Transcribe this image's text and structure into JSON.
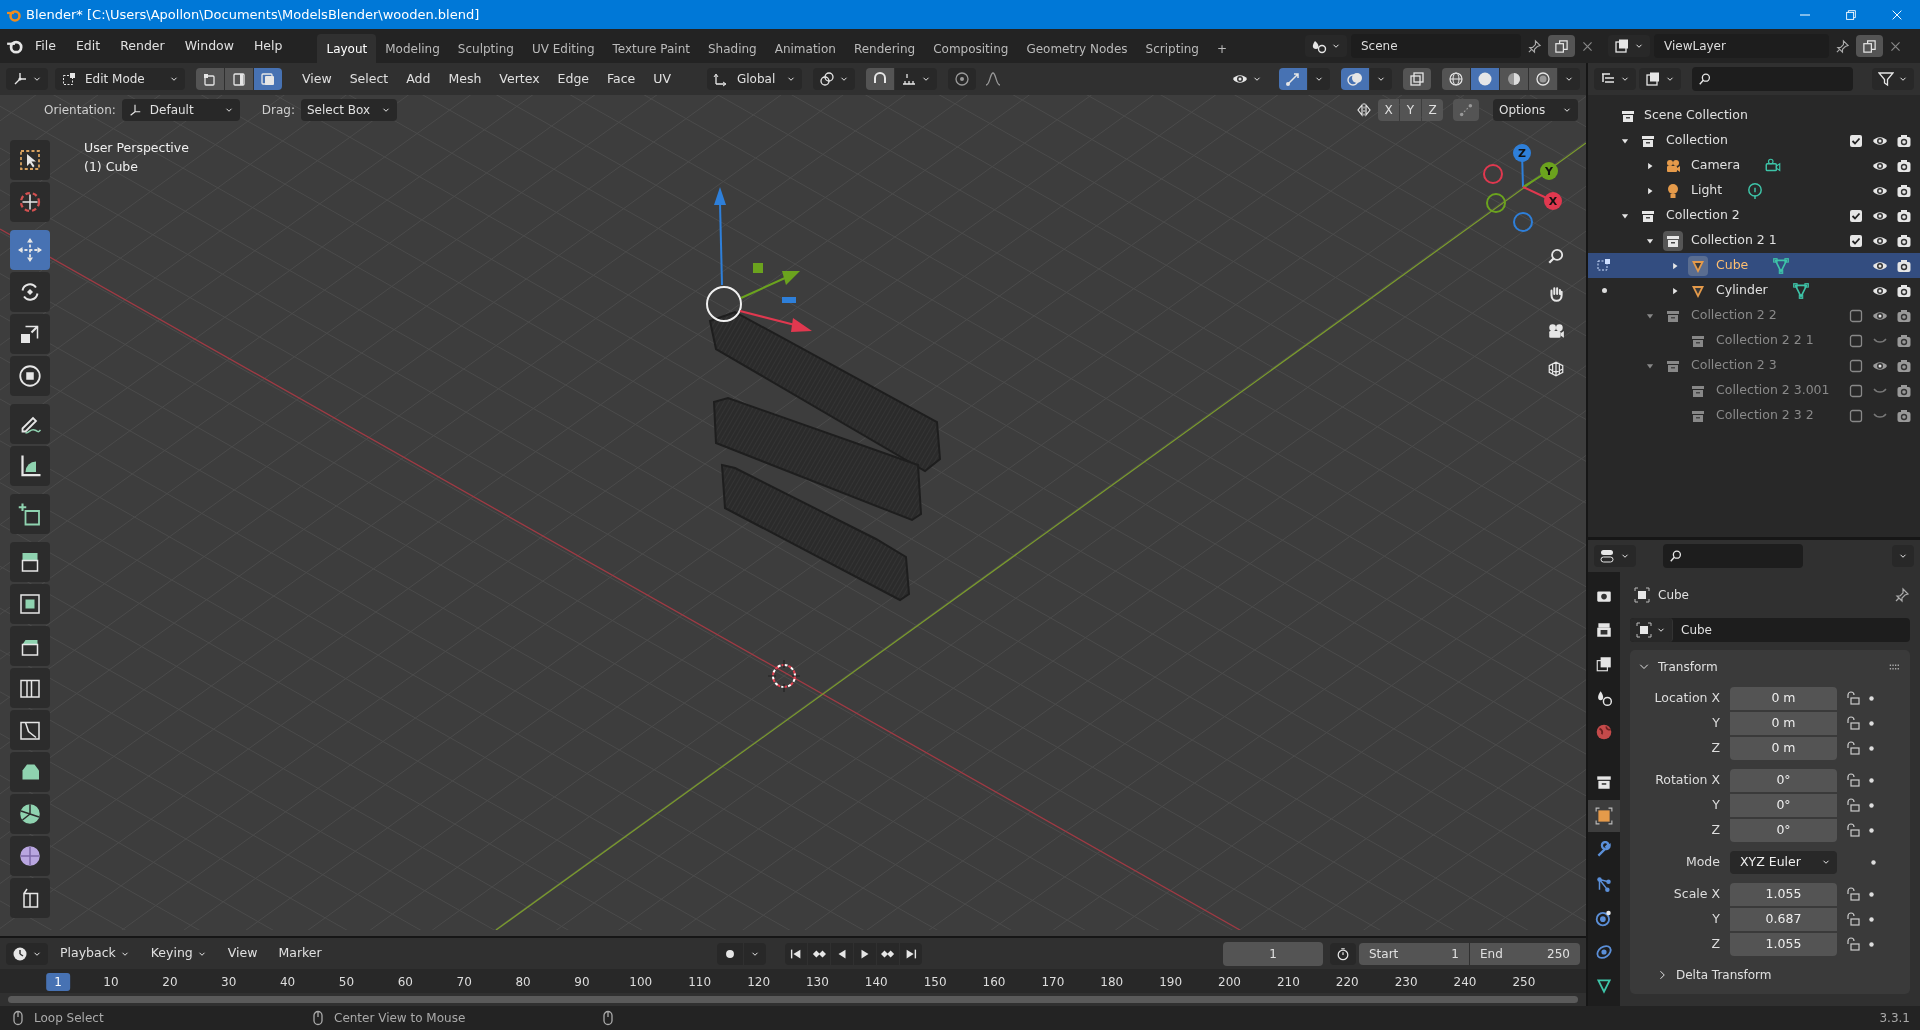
{
  "window": {
    "title": "Blender* [C:\\Users\\Apollon\\Documents\\ModelsBlender\\wooden.blend]"
  },
  "menu": [
    "File",
    "Edit",
    "Render",
    "Window",
    "Help"
  ],
  "workspaces": [
    {
      "label": "Layout",
      "selected": true
    },
    {
      "label": "Modeling",
      "selected": false
    },
    {
      "label": "Sculpting",
      "selected": false
    },
    {
      "label": "UV Editing",
      "selected": false
    },
    {
      "label": "Texture Paint",
      "selected": false
    },
    {
      "label": "Shading",
      "selected": false
    },
    {
      "label": "Animation",
      "selected": false
    },
    {
      "label": "Rendering",
      "selected": false
    },
    {
      "label": "Compositing",
      "selected": false
    },
    {
      "label": "Geometry Nodes",
      "selected": false
    },
    {
      "label": "Scripting",
      "selected": false
    }
  ],
  "add_workspace": "+",
  "scene": {
    "name": "Scene"
  },
  "view_layer": {
    "name": "ViewLayer"
  },
  "viewport_header": {
    "mode": "Edit Mode",
    "select_modes": [
      {
        "kind": "vertex",
        "selected": false
      },
      {
        "kind": "edge",
        "selected": false
      },
      {
        "kind": "face",
        "selected": true
      }
    ],
    "menus": [
      "View",
      "Select",
      "Add",
      "Mesh",
      "Vertex",
      "Edge",
      "Face",
      "UV"
    ],
    "orientation": "Global",
    "snap": {
      "on": false
    },
    "gizmos": {
      "on": true
    },
    "overlays": {
      "on": true
    },
    "xray": {
      "on": false
    },
    "shading": [
      {
        "kind": "wireframe",
        "selected": false
      },
      {
        "kind": "solid",
        "selected": true
      },
      {
        "kind": "material",
        "selected": false
      },
      {
        "kind": "rendered",
        "selected": false
      }
    ]
  },
  "tool_settings": {
    "orientation_label": "Orientation:",
    "orientation": "Default",
    "drag_label": "Drag:",
    "drag": "Select Box",
    "mirror_axes": [
      {
        "label": "X",
        "on": false
      },
      {
        "label": "Y",
        "on": false
      },
      {
        "label": "Z",
        "on": false
      }
    ],
    "options": "Options"
  },
  "viewport": {
    "overlay_text": [
      "User Perspective",
      "(1) Cube"
    ],
    "axes": [
      {
        "label": "Z",
        "color": "#2e7fd9"
      },
      {
        "label": "Y",
        "color": "#6ba31e"
      },
      {
        "label": "X",
        "color": "#e0384f"
      }
    ]
  },
  "toolbar": {
    "groups": [
      [
        {
          "kind": "select_box",
          "selected": false
        },
        {
          "kind": "cursor",
          "selected": false
        }
      ],
      [
        {
          "kind": "move",
          "selected": true
        },
        {
          "kind": "rotate",
          "selected": false
        },
        {
          "kind": "scale",
          "selected": false
        },
        {
          "kind": "transform",
          "selected": false
        }
      ],
      [
        {
          "kind": "annotate",
          "selected": false
        },
        {
          "kind": "measure",
          "selected": false
        }
      ],
      [
        {
          "kind": "add_cube",
          "selected": false
        }
      ],
      [
        {
          "kind": "extrude",
          "selected": false
        },
        {
          "kind": "inset",
          "selected": false
        },
        {
          "kind": "bevel",
          "selected": false
        },
        {
          "kind": "loop_cut",
          "selected": false
        },
        {
          "kind": "knife",
          "selected": false
        },
        {
          "kind": "poly_build",
          "selected": false
        },
        {
          "kind": "spin",
          "selected": false
        },
        {
          "kind": "smooth",
          "selected": false
        },
        {
          "kind": "shear",
          "selected": false
        }
      ]
    ]
  },
  "outliner": {
    "root": "Scene Collection",
    "items": [
      {
        "kind": "collection",
        "label": "Collection",
        "checked": true,
        "visible": true,
        "expanded": true,
        "active": false,
        "selected": false,
        "children": [
          {
            "kind": "camera",
            "label": "Camera",
            "visible": true,
            "expanded": false,
            "selected": false
          },
          {
            "kind": "light",
            "label": "Light",
            "visible": true,
            "expanded": false,
            "selected": false
          }
        ]
      },
      {
        "kind": "collection",
        "label": "Collection 2",
        "checked": true,
        "visible": true,
        "expanded": true,
        "active": false,
        "selected": false,
        "children": [
          {
            "kind": "collection",
            "label": "Collection 2 1",
            "checked": true,
            "visible": true,
            "expanded": true,
            "active": true,
            "selected": false,
            "children": [
              {
                "kind": "mesh",
                "label": "Cube",
                "visible": true,
                "expanded": false,
                "selected": true,
                "edit_mode": true
              },
              {
                "kind": "mesh",
                "label": "Cylinder",
                "visible": true,
                "expanded": false,
                "selected": false,
                "edit_mode": false
              }
            ]
          },
          {
            "kind": "collection",
            "label": "Collection 2 2",
            "checked": false,
            "visible": true,
            "expanded": true,
            "active": false,
            "selected": false,
            "children": [
              {
                "kind": "collection",
                "label": "Collection 2 2 1",
                "checked": false,
                "visible": false,
                "active": false,
                "selected": false
              }
            ]
          },
          {
            "kind": "collection",
            "label": "Collection 2 3",
            "checked": false,
            "visible": true,
            "expanded": true,
            "active": false,
            "selected": false,
            "children": [
              {
                "kind": "collection",
                "label": "Collection 2 3.001",
                "checked": false,
                "visible": false,
                "active": false,
                "selected": false
              },
              {
                "kind": "collection",
                "label": "Collection 2 3 2",
                "checked": false,
                "visible": false,
                "active": false,
                "selected": false
              }
            ]
          }
        ]
      }
    ]
  },
  "properties": {
    "tabs": [
      {
        "kind": "render",
        "selected": false
      },
      {
        "kind": "output",
        "selected": false
      },
      {
        "kind": "view_layer",
        "selected": false
      },
      {
        "kind": "scene",
        "selected": false
      },
      {
        "kind": "world",
        "selected": false
      },
      {
        "kind": "collection",
        "selected": false
      },
      {
        "kind": "object",
        "selected": true
      },
      {
        "kind": "modifiers",
        "selected": false
      },
      {
        "kind": "particles",
        "selected": false
      },
      {
        "kind": "physics",
        "selected": false
      },
      {
        "kind": "constraints",
        "selected": false
      },
      {
        "kind": "data",
        "selected": false
      }
    ],
    "object_name": "Cube",
    "datablock": "Cube",
    "panel": {
      "title": "Transform",
      "expanded": true,
      "groups": [
        {
          "rows": [
            {
              "kind": "number",
              "label": "Location X",
              "value": "0 m"
            },
            {
              "kind": "number",
              "label": "Y",
              "value": "0 m"
            },
            {
              "kind": "number",
              "label": "Z",
              "value": "0 m"
            }
          ]
        },
        {
          "rows": [
            {
              "kind": "number",
              "label": "Rotation X",
              "value": "0°"
            },
            {
              "kind": "number",
              "label": "Y",
              "value": "0°"
            },
            {
              "kind": "number",
              "label": "Z",
              "value": "0°"
            }
          ]
        },
        {
          "rows": [
            {
              "kind": "dropdown",
              "label": "Mode",
              "value": "XYZ Euler"
            }
          ]
        },
        {
          "rows": [
            {
              "kind": "number",
              "label": "Scale X",
              "value": "1.055"
            },
            {
              "kind": "number",
              "label": "Y",
              "value": "0.687"
            },
            {
              "kind": "number",
              "label": "Z",
              "value": "1.055"
            }
          ]
        }
      ]
    },
    "subpanel": {
      "title": "Delta Transform",
      "expanded": false
    }
  },
  "timeline": {
    "menus": [
      "Playback",
      "Keying",
      "View",
      "Marker"
    ],
    "current_frame": "1",
    "start_label": "Start",
    "start": "1",
    "end_label": "End",
    "end": "250",
    "ruler": [
      {
        "label": "1",
        "selected": true
      },
      {
        "label": "10",
        "selected": false
      },
      {
        "label": "20",
        "selected": false
      },
      {
        "label": "30",
        "selected": false
      },
      {
        "label": "40",
        "selected": false
      },
      {
        "label": "50",
        "selected": false
      },
      {
        "label": "60",
        "selected": false
      },
      {
        "label": "70",
        "selected": false
      },
      {
        "label": "80",
        "selected": false
      },
      {
        "label": "90",
        "selected": false
      },
      {
        "label": "100",
        "selected": false
      },
      {
        "label": "110",
        "selected": false
      },
      {
        "label": "120",
        "selected": false
      },
      {
        "label": "130",
        "selected": false
      },
      {
        "label": "140",
        "selected": false
      },
      {
        "label": "150",
        "selected": false
      },
      {
        "label": "160",
        "selected": false
      },
      {
        "label": "170",
        "selected": false
      },
      {
        "label": "180",
        "selected": false
      },
      {
        "label": "190",
        "selected": false
      },
      {
        "label": "200",
        "selected": false
      },
      {
        "label": "210",
        "selected": false
      },
      {
        "label": "220",
        "selected": false
      },
      {
        "label": "230",
        "selected": false
      },
      {
        "label": "240",
        "selected": false
      },
      {
        "label": "250",
        "selected": false
      }
    ]
  },
  "status_bar": {
    "hints": [
      "Loop Select",
      "Center View to Mouse"
    ],
    "version": "3.3.1"
  }
}
